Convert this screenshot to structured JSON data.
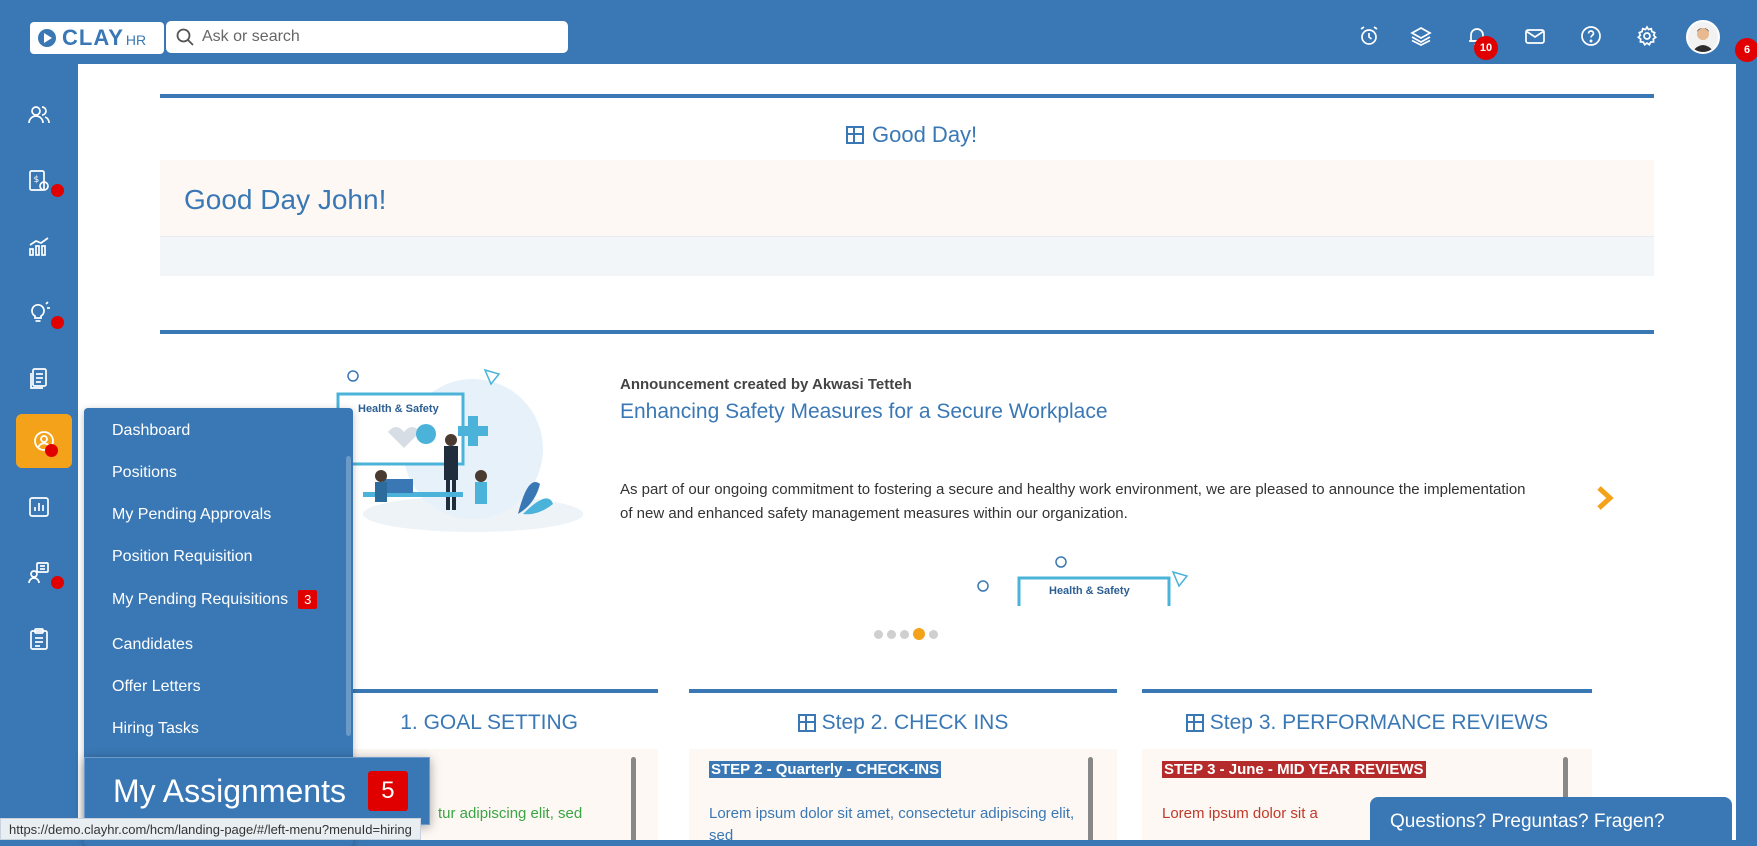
{
  "header": {
    "logo_main": "CLAY",
    "logo_sub": "HR",
    "search_placeholder": "Ask or search",
    "notification_count": "10",
    "avatar_badge": "6"
  },
  "greeting": {
    "section_title": "Good Day!",
    "message": "Good Day John!"
  },
  "announcement": {
    "author": "Announcement created by Akwasi Tetteh",
    "title": "Enhancing Safety Measures for a Secure Workplace",
    "body": "As part of our ongoing commitment to fostering a secure and healthy work environment, we are pleased to announce the implementation of new and enhanced safety management measures within our organization.",
    "image_label": "Health & Safety",
    "slide_count": 5,
    "active_slide": 4
  },
  "steps": [
    {
      "title": "1. GOAL SETTING",
      "head": "",
      "lorem": "tur adipiscing elit, sed"
    },
    {
      "title": "Step 2. CHECK INS",
      "head": "STEP 2 - Quarterly - CHECK-INS",
      "lorem": "Lorem ipsum dolor sit amet, consectetur adipiscing elit, sed"
    },
    {
      "title": "Step 3. PERFORMANCE REVIEWS",
      "head": "STEP 3 - June - MID YEAR REVIEWS",
      "lorem": "Lorem ipsum dolor sit a"
    }
  ],
  "menu": {
    "items": [
      {
        "label": "Dashboard"
      },
      {
        "label": "Positions"
      },
      {
        "label": "My Pending Approvals"
      },
      {
        "label": "Position Requisition"
      },
      {
        "label": "My Pending Requisitions",
        "badge": "3"
      },
      {
        "label": "Candidates"
      },
      {
        "label": "Offer Letters"
      },
      {
        "label": "Hiring Tasks"
      }
    ],
    "highlight": {
      "label": "My Assignments",
      "badge": "5"
    }
  },
  "status_url": "https://demo.clayhr.com/hcm/landing-page/#/left-menu?menuId=hiring",
  "chat": {
    "label": "Questions? Preguntas? Fragen?"
  },
  "colors": {
    "primary": "#3a78b5",
    "accent": "#f5a21b",
    "alert": "#e10000"
  }
}
